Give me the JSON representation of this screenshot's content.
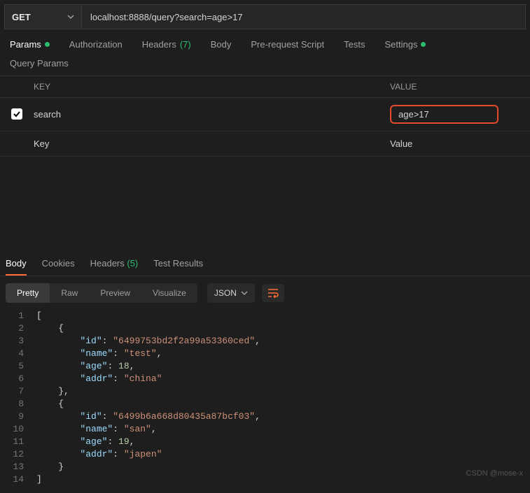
{
  "request": {
    "method": "GET",
    "url": "localhost:8888/query?search=age>17",
    "tabs": {
      "params": "Params",
      "auth": "Authorization",
      "headers": "Headers",
      "headers_count": "(7)",
      "body": "Body",
      "prereq": "Pre-request Script",
      "tests": "Tests",
      "settings": "Settings"
    },
    "section_label": "Query Params",
    "table": {
      "key_header": "KEY",
      "value_header": "VALUE",
      "rows": [
        {
          "checked": true,
          "key": "search",
          "value": "age>17"
        }
      ],
      "placeholder": {
        "key": "Key",
        "value": "Value"
      }
    }
  },
  "response": {
    "tabs": {
      "body": "Body",
      "cookies": "Cookies",
      "headers": "Headers",
      "headers_count": "(5)",
      "tests": "Test Results"
    },
    "views": {
      "pretty": "Pretty",
      "raw": "Raw",
      "preview": "Preview",
      "visualize": "Visualize"
    },
    "format": "JSON",
    "json": [
      {
        "id": "6499753bd2f2a99a53360ced",
        "name": "test",
        "age": 18,
        "addr": "china"
      },
      {
        "id": "6499b6a668d80435a87bcf03",
        "name": "san",
        "age": 19,
        "addr": "japen"
      }
    ]
  },
  "watermark": "CSDN @mose-x"
}
